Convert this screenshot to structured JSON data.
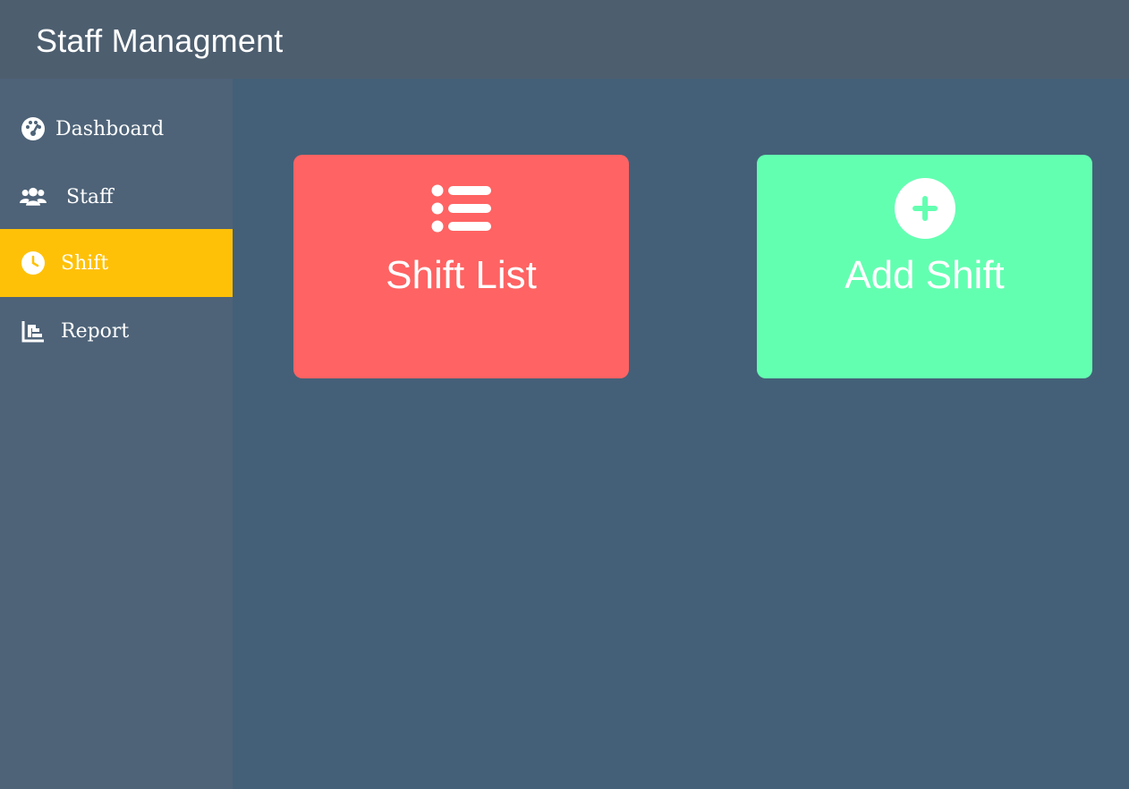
{
  "header": {
    "title": "Staff Managment"
  },
  "sidebar": {
    "items": [
      {
        "label": "Dashboard",
        "icon": "dashboard-gauge-icon",
        "active": false
      },
      {
        "label": "Staff",
        "icon": "users-icon",
        "active": false
      },
      {
        "label": "Shift",
        "icon": "clock-icon",
        "active": true
      },
      {
        "label": "Report",
        "icon": "bar-chart-icon",
        "active": false
      }
    ],
    "active_color": "#ffc107"
  },
  "main": {
    "cards": [
      {
        "label": "Shift List",
        "icon": "list-icon",
        "color": "#ff6363"
      },
      {
        "label": "Add Shift",
        "icon": "plus-circle-icon",
        "color": "#63ffb1"
      }
    ]
  }
}
